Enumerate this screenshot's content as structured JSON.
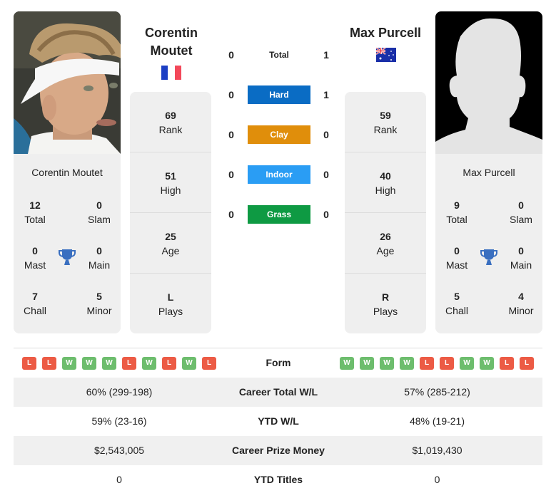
{
  "colors": {
    "hard": "#0a6cc4",
    "clay": "#e08e0b",
    "indoor": "#2a9df4",
    "grass": "#0e9a43",
    "win": "#6dbd6d",
    "loss": "#ec5b45",
    "trophy": "#3a6fc0"
  },
  "player1": {
    "name_line1": "Corentin",
    "name_line2": "Moutet",
    "full_name": "Corentin Moutet",
    "country_flag": "france-flag",
    "titles": {
      "total": {
        "value": "12",
        "label": "Total"
      },
      "slam": {
        "value": "0",
        "label": "Slam"
      },
      "mast": {
        "value": "0",
        "label": "Mast"
      },
      "main": {
        "value": "0",
        "label": "Main"
      },
      "chall": {
        "value": "7",
        "label": "Chall"
      },
      "minor": {
        "value": "5",
        "label": "Minor"
      }
    },
    "stats": [
      {
        "value": "69",
        "label": "Rank"
      },
      {
        "value": "51",
        "label": "High"
      },
      {
        "value": "25",
        "label": "Age"
      },
      {
        "value": "L",
        "label": "Plays"
      }
    ]
  },
  "player2": {
    "name": "Max Purcell",
    "full_name": "Max Purcell",
    "country_flag": "australia-flag",
    "titles": {
      "total": {
        "value": "9",
        "label": "Total"
      },
      "slam": {
        "value": "0",
        "label": "Slam"
      },
      "mast": {
        "value": "0",
        "label": "Mast"
      },
      "main": {
        "value": "0",
        "label": "Main"
      },
      "chall": {
        "value": "5",
        "label": "Chall"
      },
      "minor": {
        "value": "4",
        "label": "Minor"
      }
    },
    "stats": [
      {
        "value": "59",
        "label": "Rank"
      },
      {
        "value": "40",
        "label": "High"
      },
      {
        "value": "26",
        "label": "Age"
      },
      {
        "value": "R",
        "label": "Plays"
      }
    ]
  },
  "h2h": [
    {
      "label": "Total",
      "p1": "0",
      "p2": "1"
    },
    {
      "label": "Hard",
      "p1": "0",
      "p2": "1"
    },
    {
      "label": "Clay",
      "p1": "0",
      "p2": "0"
    },
    {
      "label": "Indoor",
      "p1": "0",
      "p2": "0"
    },
    {
      "label": "Grass",
      "p1": "0",
      "p2": "0"
    }
  ],
  "table": {
    "form": {
      "label": "Form",
      "p1": [
        "L",
        "L",
        "W",
        "W",
        "W",
        "L",
        "W",
        "L",
        "W",
        "L"
      ],
      "p2": [
        "W",
        "W",
        "W",
        "W",
        "L",
        "L",
        "W",
        "W",
        "L",
        "L"
      ]
    },
    "rows": [
      {
        "label": "Career Total W/L",
        "p1": "60% (299-198)",
        "p2": "57% (285-212)"
      },
      {
        "label": "YTD W/L",
        "p1": "59% (23-16)",
        "p2": "48% (19-21)"
      },
      {
        "label": "Career Prize Money",
        "p1": "$2,543,005",
        "p2": "$1,019,430"
      },
      {
        "label": "YTD Titles",
        "p1": "0",
        "p2": "0"
      }
    ]
  }
}
